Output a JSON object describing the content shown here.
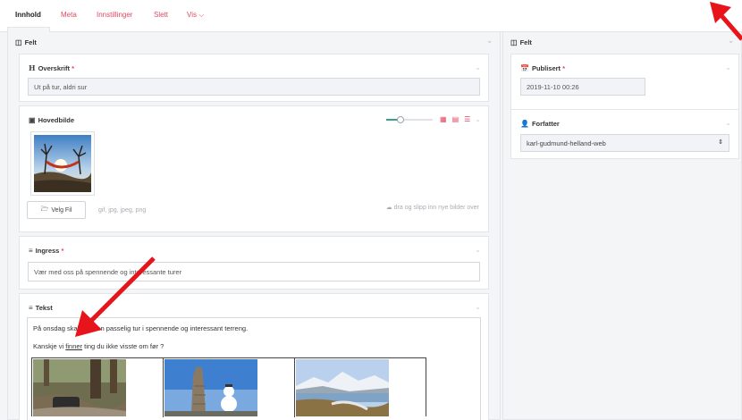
{
  "tabs": [
    {
      "label": "Innhold"
    },
    {
      "label": "Meta"
    },
    {
      "label": "Innstillinger"
    },
    {
      "label": "Slett"
    },
    {
      "label": "Vis ⌵"
    }
  ],
  "left_column": {
    "title": "Felt",
    "heading_panel": {
      "label": "Overskrift",
      "required": "*",
      "value": "Ut på tur, aldri sur"
    },
    "image_panel": {
      "label": "Hovedbilde",
      "zoom_level": 0.3,
      "choose_file_label": "Velg Fil",
      "file_types": "gif, jpg, jpeg, png",
      "drop_hint": "dra og slipp inn nye bilder over"
    },
    "ingress_panel": {
      "label": "Ingress",
      "required": "*",
      "value": "Vær med oss på spennende og interessante turer"
    },
    "text_panel": {
      "label": "Tekst",
      "line1": "På onsdag skal vi gå en passelig tur i spennende og interessant terreng.",
      "line2_prefix": "Kanskje vi ",
      "line2_link": "finner",
      "line2_suffix": " ting du ikke visste om før ?"
    }
  },
  "right_column": {
    "title": "Felt",
    "published_panel": {
      "label": "Publisert",
      "required": "*",
      "value": "2019-11-10 00:26"
    },
    "author_panel": {
      "label": "Forfatter",
      "selected": "karl-gudmund-helland-web"
    }
  },
  "colors": {
    "accent": "#e0475c",
    "slider": "#3aa08a",
    "annotation_arrow": "#e8141b"
  }
}
